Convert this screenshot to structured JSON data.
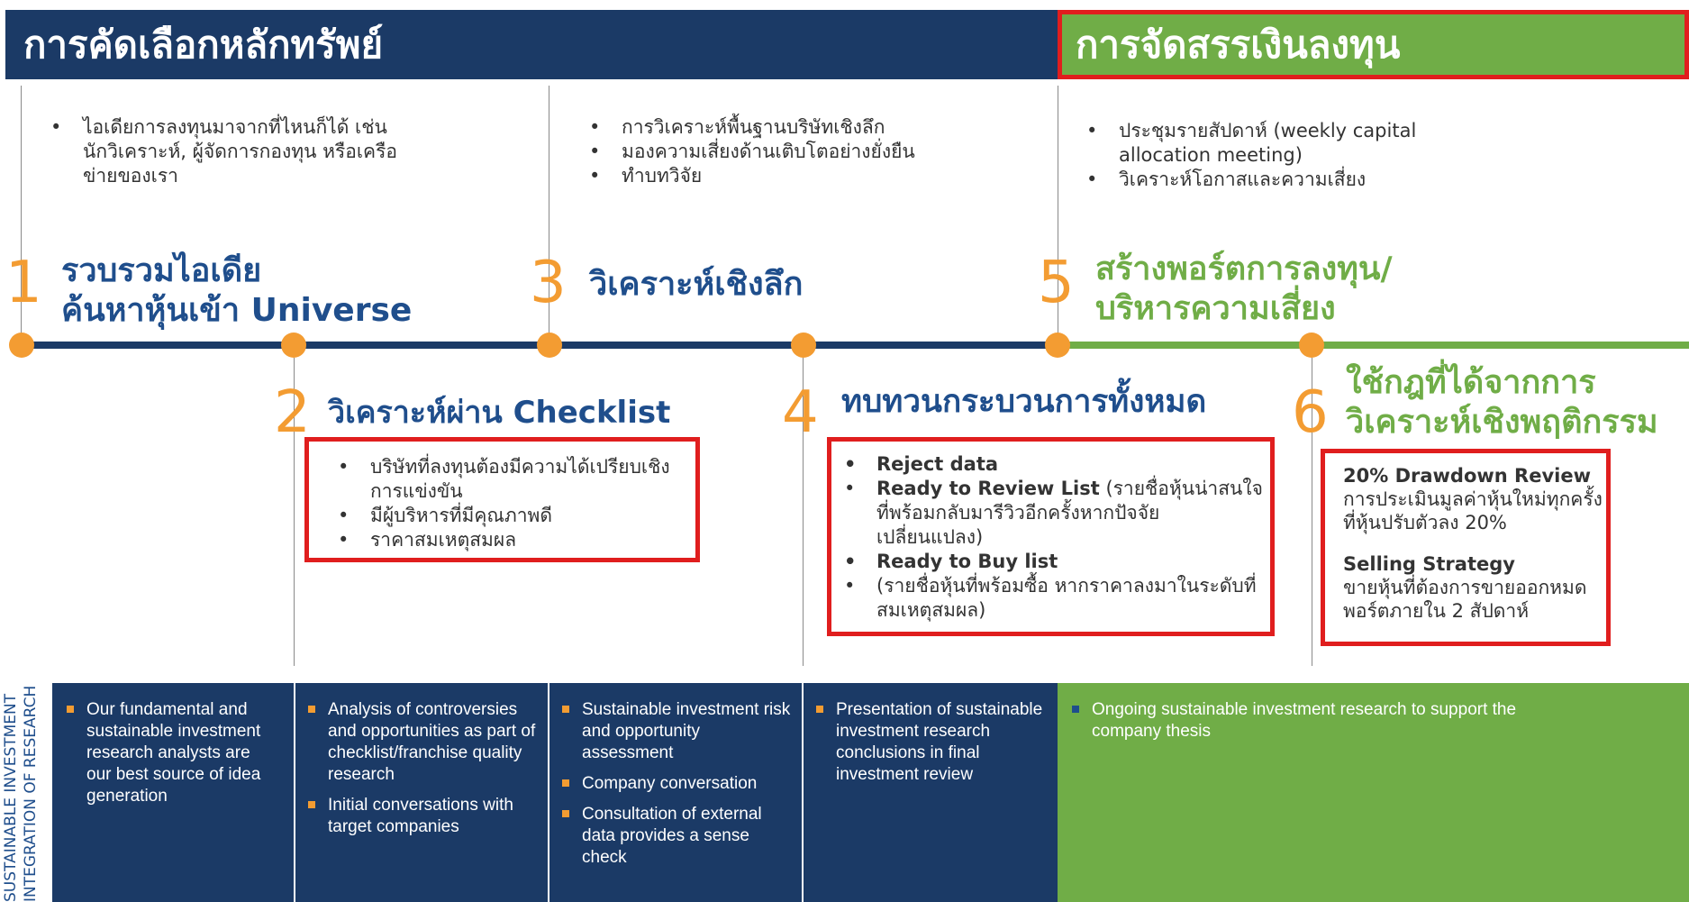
{
  "header": {
    "left_title": "การคัดเลือกหลักทรัพย์",
    "right_title": "การจัดสรรเงินลงทุน"
  },
  "top_bullets": {
    "col1": [
      "ไอเดียการลงทุนมาจากที่ไหนก็ได้ เช่น นักวิเคราะห์, ผู้จัดการกองทุน หรือเครือข่ายของเรา"
    ],
    "col2": [
      "การวิเคราะห์พื้นฐานบริษัทเชิงลึก",
      "มองความเสี่ยงด้านเติบโตอย่างยั่งยืน",
      "ทำบทวิจัย"
    ],
    "col3": [
      "ประชุมรายสัปดาห์ (weekly capital allocation meeting)",
      "วิเคราะห์โอกาสและความเสี่ยง"
    ]
  },
  "steps": [
    {
      "num": "1",
      "title_line1": "รวบรวมไอเดีย",
      "title_line2": "ค้นหาหุ้นเข้า Universe"
    },
    {
      "num": "2",
      "title": "วิเคราะห์ผ่าน Checklist"
    },
    {
      "num": "3",
      "title": "วิเคราะห์เชิงลึก"
    },
    {
      "num": "4",
      "title": "ทบทวนกระบวนการทั้งหมด"
    },
    {
      "num": "5",
      "title_line1": "สร้างพอร์ตการลงทุน/",
      "title_line2": "บริหารความเสี่ยง"
    },
    {
      "num": "6",
      "title_line1": "ใช้กฎที่ได้จากการ",
      "title_line2": "วิเคราะห์เชิงพฤติกรรม"
    }
  ],
  "box2": [
    "บริษัทที่ลงทุนต้องมีความได้เปรียบเชิงการแข่งขัน",
    "มีผู้บริหารที่มีคุณภาพดี",
    "ราคาสมเหตุสมผล"
  ],
  "box4": {
    "item1": "Reject data",
    "item2_bold": "Ready to Review List",
    "item2_rest": " (รายชื่อหุ้นน่าสนใจที่พร้อมกลับมารีวิวอีกครั้งหากปัจจัยเปลี่ยนแปลง)",
    "item3": "Ready to Buy list",
    "item4": "(รายชื่อหุ้นที่พร้อมซื้อ หากราคาลงมาในระดับที่สมเหตุสมผล)"
  },
  "box6": {
    "h1": "20% Drawdown Review",
    "t1": "การประเมินมูลค่าหุ้นใหม่ทุกครั้งที่หุ้นปรับตัวลง 20%",
    "h2": "Selling Strategy",
    "t2": "ขายหุ้นที่ต้องการขายออกหมดพอร์ตภายใน 2 สัปดาห์"
  },
  "side_label": {
    "line1": "SUSTAINABLE INVESTMENT",
    "line2": "INTEGRATION OF RESEARCH"
  },
  "bottom": {
    "col1": [
      "Our fundamental and sustainable investment research analysts are our best source of idea generation"
    ],
    "col2": [
      "Analysis of controversies and opportunities as part of checklist/franchise quality research",
      "Initial conversations with target companies"
    ],
    "col3": [
      "Sustainable investment risk and opportunity assessment",
      "Company conversation",
      "Consultation of external data provides a sense check"
    ],
    "col4": [
      "Presentation of sustainable investment research conclusions in final investment review"
    ],
    "col5": [
      "Ongoing sustainable investment research to support the company thesis"
    ]
  },
  "colors": {
    "navy": "#1b3a66",
    "green": "#70ad47",
    "orange": "#f39c32",
    "red": "#e01e1e"
  }
}
